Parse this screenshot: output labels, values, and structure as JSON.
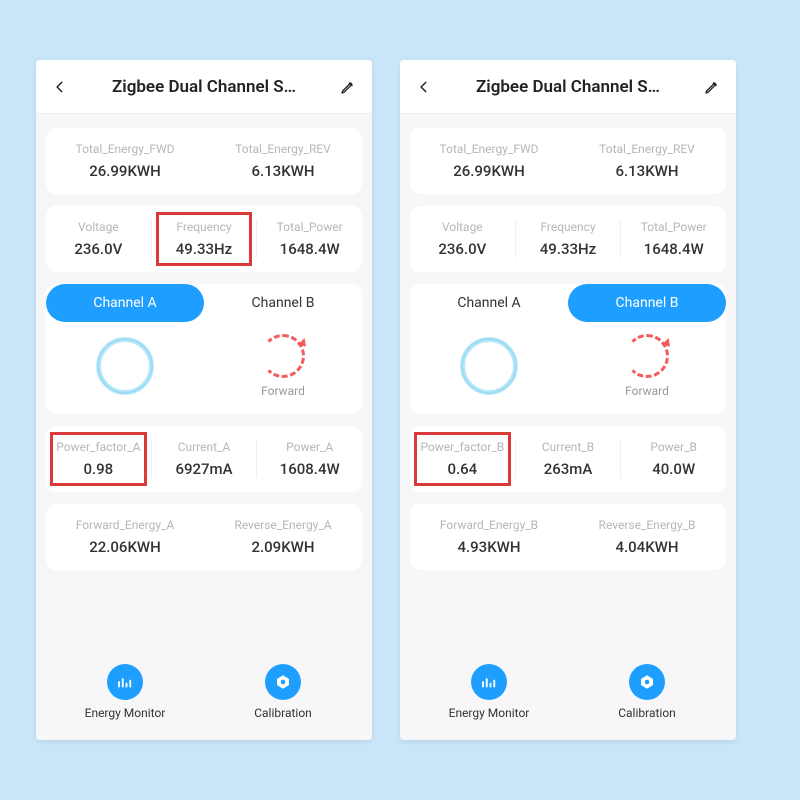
{
  "screens": [
    {
      "header": {
        "title": "Zigbee Dual Channel S…"
      },
      "topEnergy": {
        "fwd_label": "Total_Energy_FWD",
        "fwd_value": "26.99KWH",
        "rev_label": "Total_Energy_REV",
        "rev_value": "6.13KWH"
      },
      "mains": {
        "voltage_label": "Voltage",
        "voltage_value": "236.0V",
        "freq_label": "Frequency",
        "freq_value": "49.33Hz",
        "power_label": "Total_Power",
        "power_value": "1648.4W"
      },
      "tabs": {
        "a": "Channel A",
        "b": "Channel B",
        "active": "a"
      },
      "forward_label": "Forward",
      "channel_stats": {
        "pf_label": "Power_factor_A",
        "pf_value": "0.98",
        "cur_label": "Current_A",
        "cur_value": "6927mA",
        "pow_label": "Power_A",
        "pow_value": "1608.4W"
      },
      "channel_energy": {
        "fwd_label": "Forward_Energy_A",
        "fwd_value": "22.06KWH",
        "rev_label": "Reverse_Energy_A",
        "rev_value": "2.09KWH"
      },
      "bottom": {
        "monitor": "Energy Monitor",
        "calib": "Calibration"
      },
      "highlight": {
        "freq": true,
        "pf": true
      }
    },
    {
      "header": {
        "title": "Zigbee Dual Channel S…"
      },
      "topEnergy": {
        "fwd_label": "Total_Energy_FWD",
        "fwd_value": "26.99KWH",
        "rev_label": "Total_Energy_REV",
        "rev_value": "6.13KWH"
      },
      "mains": {
        "voltage_label": "Voltage",
        "voltage_value": "236.0V",
        "freq_label": "Frequency",
        "freq_value": "49.33Hz",
        "power_label": "Total_Power",
        "power_value": "1648.4W"
      },
      "tabs": {
        "a": "Channel A",
        "b": "Channel B",
        "active": "b"
      },
      "forward_label": "Forward",
      "channel_stats": {
        "pf_label": "Power_factor_B",
        "pf_value": "0.64",
        "cur_label": "Current_B",
        "cur_value": "263mA",
        "pow_label": "Power_B",
        "pow_value": "40.0W"
      },
      "channel_energy": {
        "fwd_label": "Forward_Energy_B",
        "fwd_value": "4.93KWH",
        "rev_label": "Reverse_Energy_B",
        "rev_value": "4.04KWH"
      },
      "bottom": {
        "monitor": "Energy Monitor",
        "calib": "Calibration"
      },
      "highlight": {
        "freq": false,
        "pf": true
      }
    }
  ]
}
